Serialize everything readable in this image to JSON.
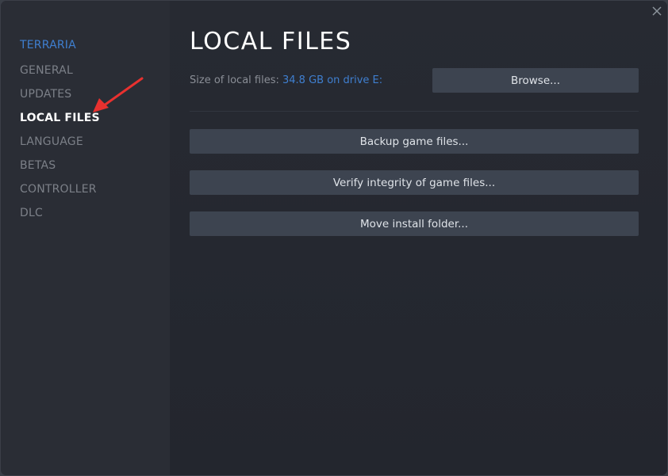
{
  "window": {
    "close_icon": "close-icon"
  },
  "sidebar": {
    "game_title": "TERRARIA",
    "items": [
      {
        "label": "GENERAL",
        "active": false
      },
      {
        "label": "UPDATES",
        "active": false
      },
      {
        "label": "LOCAL FILES",
        "active": true
      },
      {
        "label": "LANGUAGE",
        "active": false
      },
      {
        "label": "BETAS",
        "active": false
      },
      {
        "label": "CONTROLLER",
        "active": false
      },
      {
        "label": "DLC",
        "active": false
      }
    ]
  },
  "annotation": {
    "arrow_icon": "red-arrow-icon",
    "color": "#e8312f"
  },
  "main": {
    "title": "LOCAL FILES",
    "size_label": "Size of local files:",
    "size_value": "34.8 GB on drive E:",
    "browse_label": "Browse...",
    "buttons": [
      {
        "label": "Backup game files..."
      },
      {
        "label": "Verify integrity of game files..."
      },
      {
        "label": "Move install folder..."
      }
    ]
  },
  "colors": {
    "accent": "#3f7fd0",
    "background": "#23262e",
    "sidebar": "#2a2d35",
    "button": "#3d4450"
  }
}
